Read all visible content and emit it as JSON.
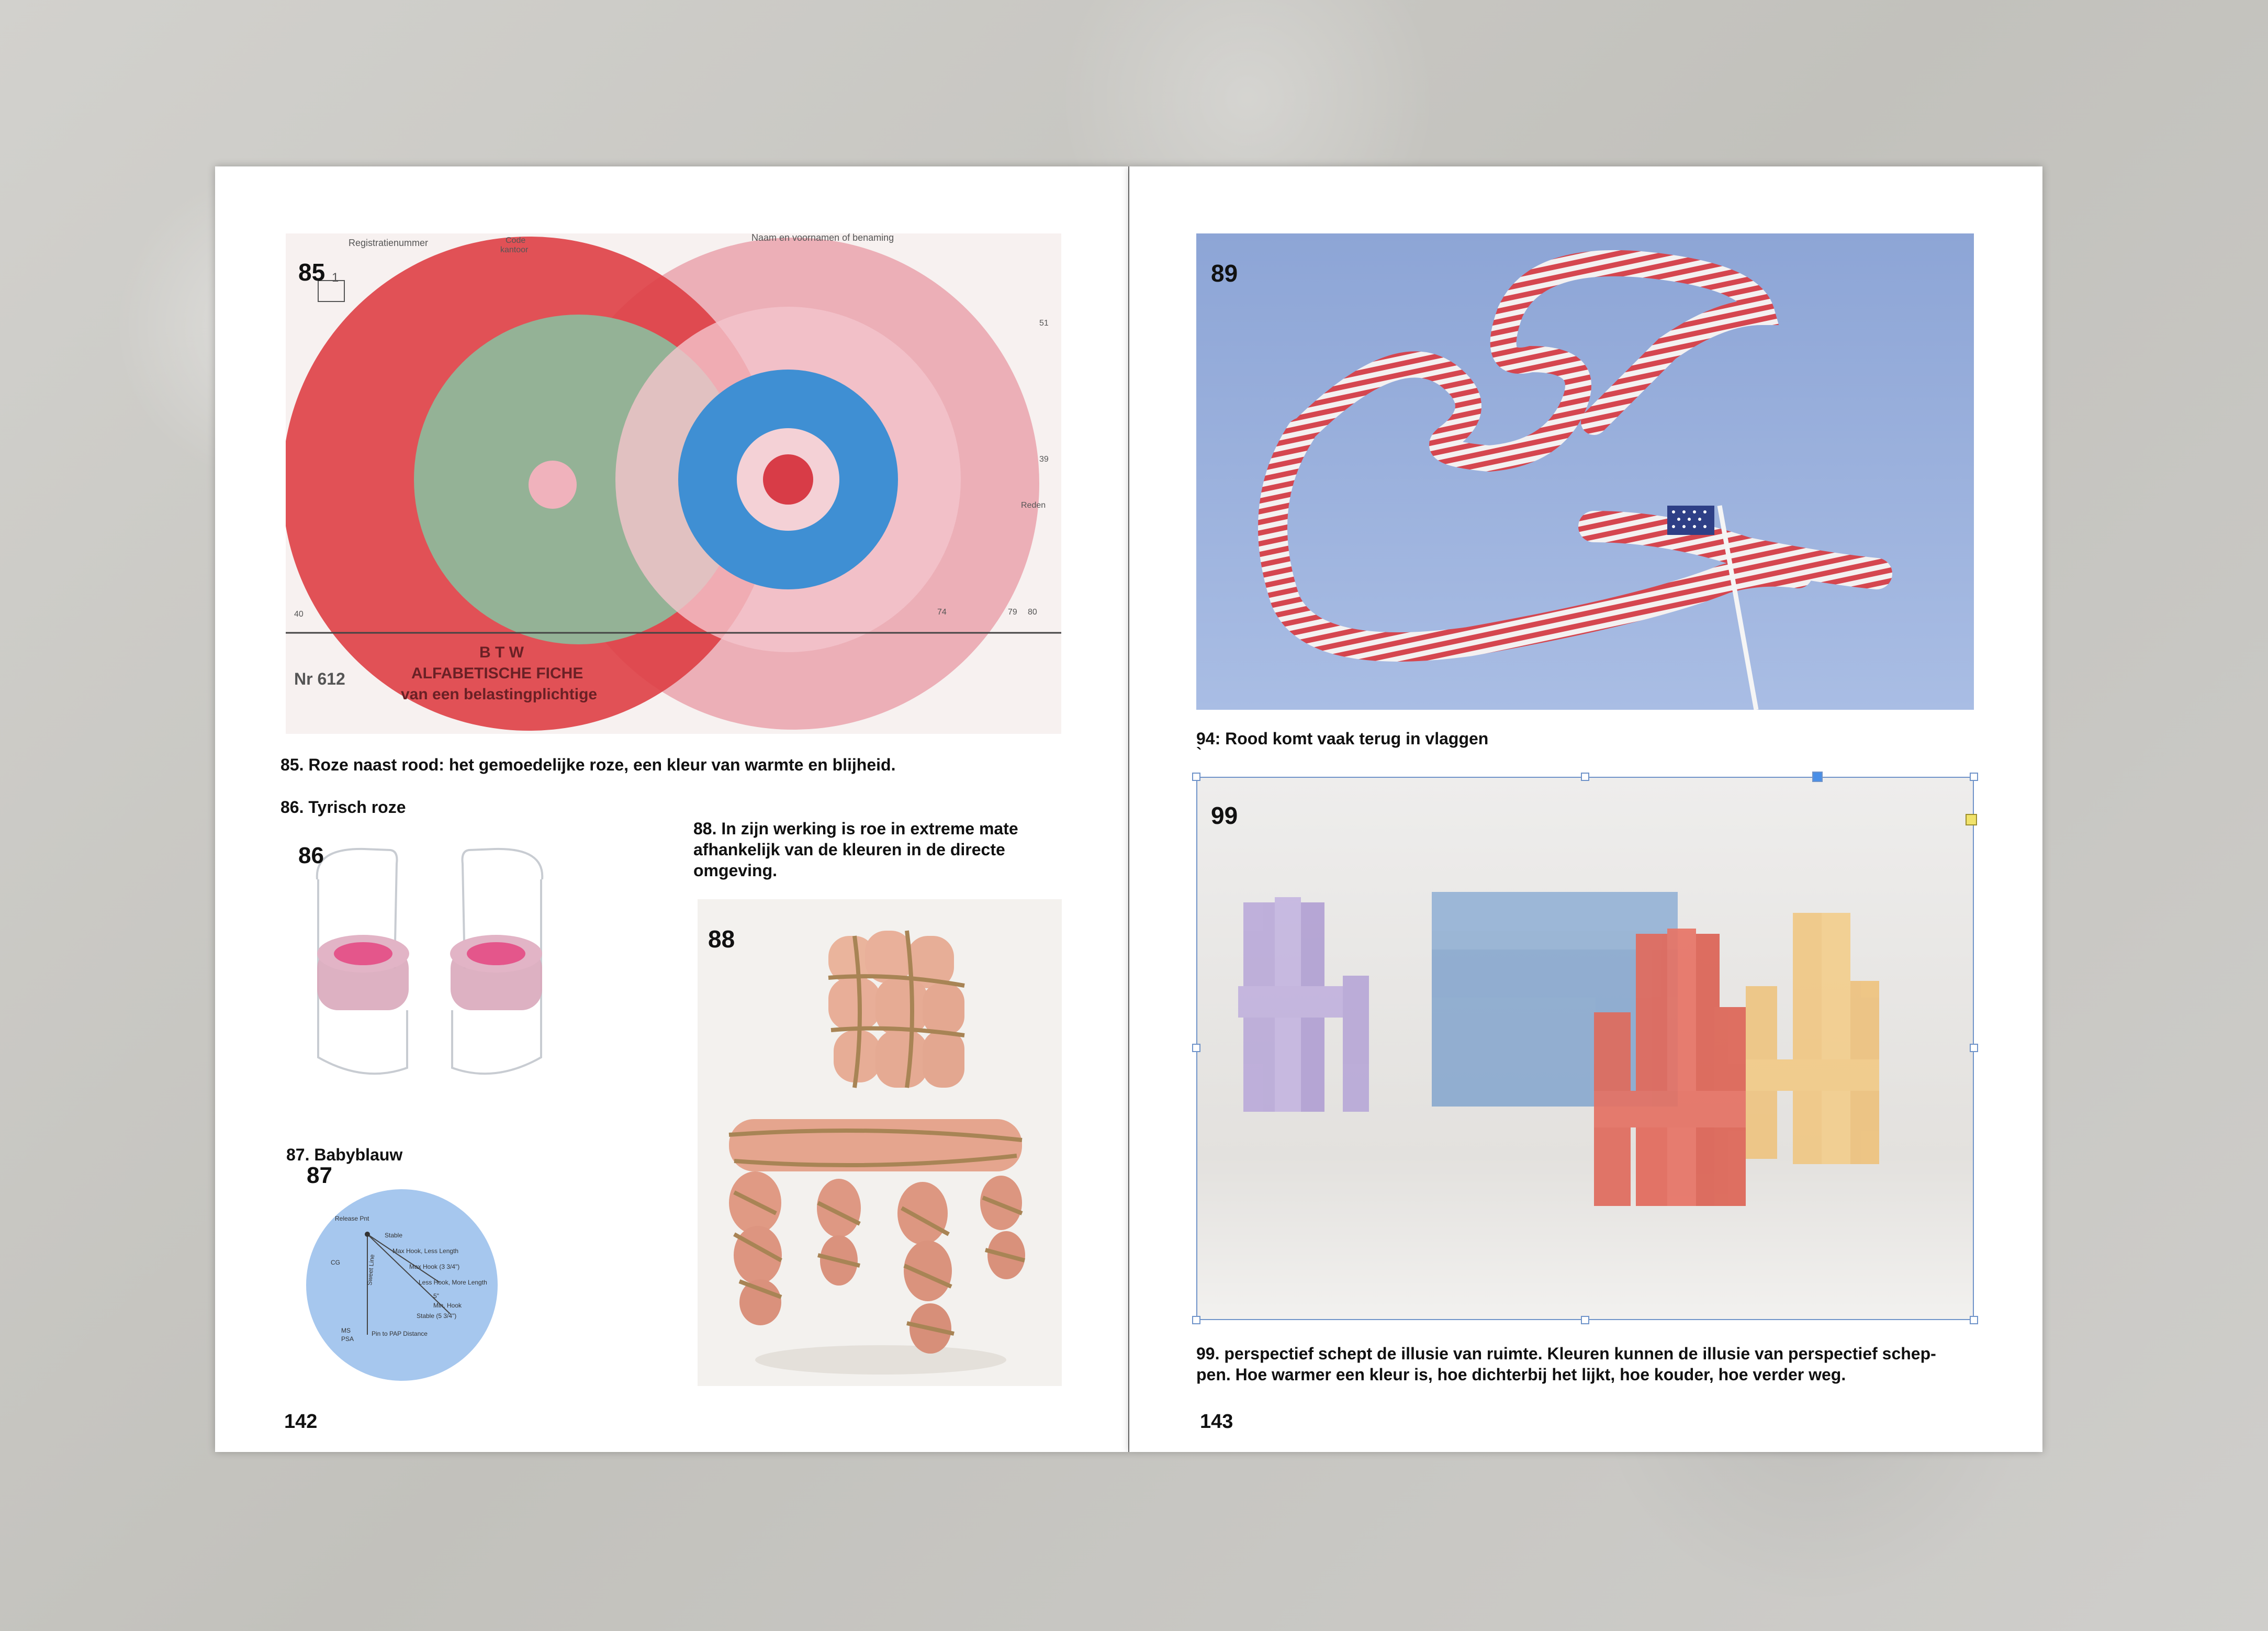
{
  "left_page": {
    "folio": "142",
    "fig85": {
      "num": "85",
      "form_labels": {
        "registration": "Registratienummer",
        "name": "Naam en voornamen of benaming",
        "code": "Code",
        "kantoor": "kantoor",
        "btw": "B T W",
        "fiche": "ALFABETISCHE FICHE",
        "belasting": "van een belastingplichtige",
        "nr": "Nr 612",
        "n51": "51",
        "n39": "39",
        "n40": "40",
        "n74": "74",
        "n79": "79",
        "n80": "80",
        "n1": "1",
        "reden": "Reden"
      }
    },
    "caption85": "85. Roze naast rood: het gemoedelijke roze, een kleur van warmte en blijheid.",
    "caption86": "86. Tyrisch roze",
    "fig86_num": "86",
    "caption87": "87. Babyblauw",
    "fig87": {
      "num": "87",
      "labels": {
        "release": "Release Pnt",
        "stable": "Stable",
        "co": "CG",
        "max_hook": "Max Hook, Less Length",
        "max_hook2": "Max Hook (3 3/4\")",
        "less_hook": "Less Hook, More Length",
        "five": "5\"",
        "min_hook": "Min. Hook",
        "stable2": "Stable (5 3/4\")",
        "pin": "Pin to PAP Distance",
        "psa": "PSA",
        "sweet": "Sweet Line",
        "ms": "MS"
      }
    },
    "caption88": "88. In zijn werking is roe in extreme mate afhankelijk van de kleuren in de directe omgeving.",
    "fig88_num": "88"
  },
  "right_page": {
    "folio": "143",
    "fig89_num": "89",
    "caption94": "94: Rood komt vaak terug in vlaggen",
    "caption94_mark": "`",
    "fig99_num": "99",
    "caption99": "99. perspectief schept de illusie van ruimte. Kleuren kunnen de illusie van perspectief schep-pen. Hoe warmer een kleur is, hoe dichterbij het lijkt, hoe kouder, hoe verder weg."
  },
  "colors": {
    "red": "#de3f45",
    "pink": "#eaa3ad",
    "green": "#8fb79a",
    "blue": "#3f8fd3",
    "sky": "#93abd9",
    "baby_blue": "#a6c7ee",
    "selection": "#6f93c9"
  }
}
